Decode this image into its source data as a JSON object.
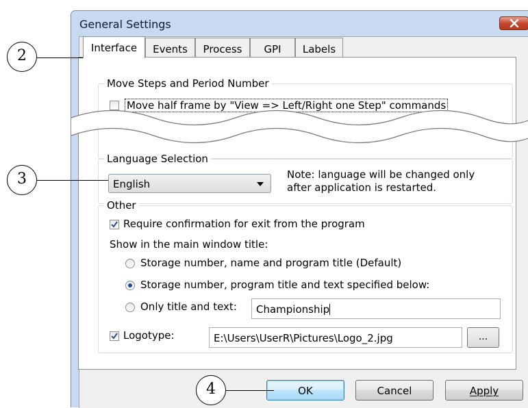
{
  "window": {
    "title": "General Settings"
  },
  "tabs": [
    {
      "label": "Interface",
      "active": true
    },
    {
      "label": "Events"
    },
    {
      "label": "Process"
    },
    {
      "label": "GPI"
    },
    {
      "label": "Labels"
    }
  ],
  "move_steps": {
    "group_title": "Move Steps and Period Number",
    "half_frame_label": "Move half frame by \"View => Left/Right one Step\" commands",
    "half_frame_checked": false
  },
  "language": {
    "group_title": "Language Selection",
    "selected": "English",
    "note_line1": "Note: language will be changed only",
    "note_line2": "after application is restarted."
  },
  "other": {
    "group_title": "Other",
    "confirm_exit_label": "Require confirmation for exit from the program",
    "confirm_exit_checked": true,
    "title_heading": "Show in the main window title:",
    "radio_options": [
      "Storage number, name and program title (Default)",
      "Storage number, program title and text specified below:",
      "Only title and text:"
    ],
    "radio_selected_index": 1,
    "title_text_value": "Championship",
    "logotype_label": "Logotype:",
    "logotype_checked": true,
    "logotype_path": "E:\\Users\\UserR\\Pictures\\Logo_2.jpg",
    "browse_label": "..."
  },
  "buttons": {
    "ok": "OK",
    "cancel": "Cancel",
    "apply": "Apply"
  },
  "callouts": [
    "2",
    "3",
    "4"
  ],
  "colors": {
    "frame": "#c7daf0",
    "close": "#c4412a",
    "default_button": "#bee6fd"
  },
  "icons": [
    "close-icon",
    "chevron-down-icon",
    "checkmark-icon"
  ]
}
